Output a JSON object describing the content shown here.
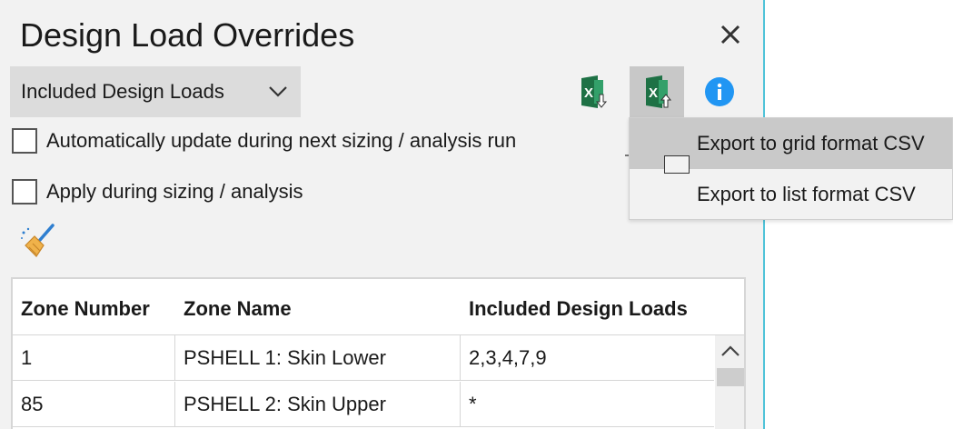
{
  "window": {
    "title": "Design Load Overrides",
    "close_icon": "close-icon"
  },
  "toolbar": {
    "dropdown_value": "Included Design Loads",
    "dropdown_icon": "chevron-down-icon",
    "import_icon": "excel-import-icon",
    "export_icon": "excel-export-icon",
    "info_icon": "info-icon",
    "colors": {
      "excel_green": "#1e7145",
      "info_blue": "#2196f3"
    }
  },
  "options": {
    "auto_update_label": "Automatically update during next sizing / analysis run",
    "auto_update_checked": false,
    "apply_label": "Apply during sizing / analysis",
    "apply_checked": false
  },
  "actions": {
    "clear_icon": "broom-icon"
  },
  "grid": {
    "columns": [
      "Zone Number",
      "Zone Name",
      "Included Design Loads"
    ],
    "rows": [
      {
        "zone_number": "1",
        "zone_name": "PSHELL 1: Skin Lower",
        "loads": "2,3,4,7,9"
      },
      {
        "zone_number": "85",
        "zone_name": "PSHELL 2: Skin Upper",
        "loads": "*"
      }
    ]
  },
  "export_menu": {
    "items": [
      {
        "label": "Export to grid format CSV",
        "highlighted": true
      },
      {
        "label": "Export to list format CSV",
        "highlighted": false
      }
    ]
  }
}
